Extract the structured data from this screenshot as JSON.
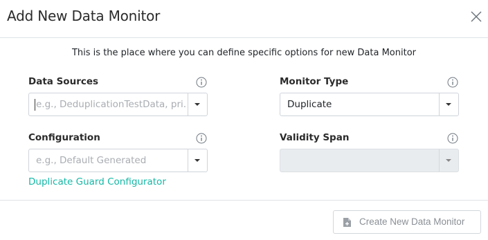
{
  "dialog": {
    "title": "Add New Data Monitor",
    "intro": "This is the place where you can define specific options for new Data Monitor"
  },
  "fields": {
    "data_sources": {
      "label": "Data Sources",
      "placeholder": "e.g., DeduplicationTestData, pri...",
      "value": ""
    },
    "monitor_type": {
      "label": "Monitor Type",
      "value": "Duplicate"
    },
    "configuration": {
      "label": "Configuration",
      "placeholder": "e.g., Default Generated",
      "value": ""
    },
    "validity_span": {
      "label": "Validity Span",
      "value": ""
    }
  },
  "links": {
    "configurator": "Duplicate Guard Configurator"
  },
  "footer": {
    "create_button": "Create New Data Monitor"
  },
  "icons": {
    "close": "close-icon",
    "info": "info-icon",
    "caret": "chevron-down-icon",
    "file_add": "file-add-icon"
  },
  "colors": {
    "accent": "#14b8a6",
    "border": "#ced4da",
    "disabled_bg": "#e9ecef"
  }
}
